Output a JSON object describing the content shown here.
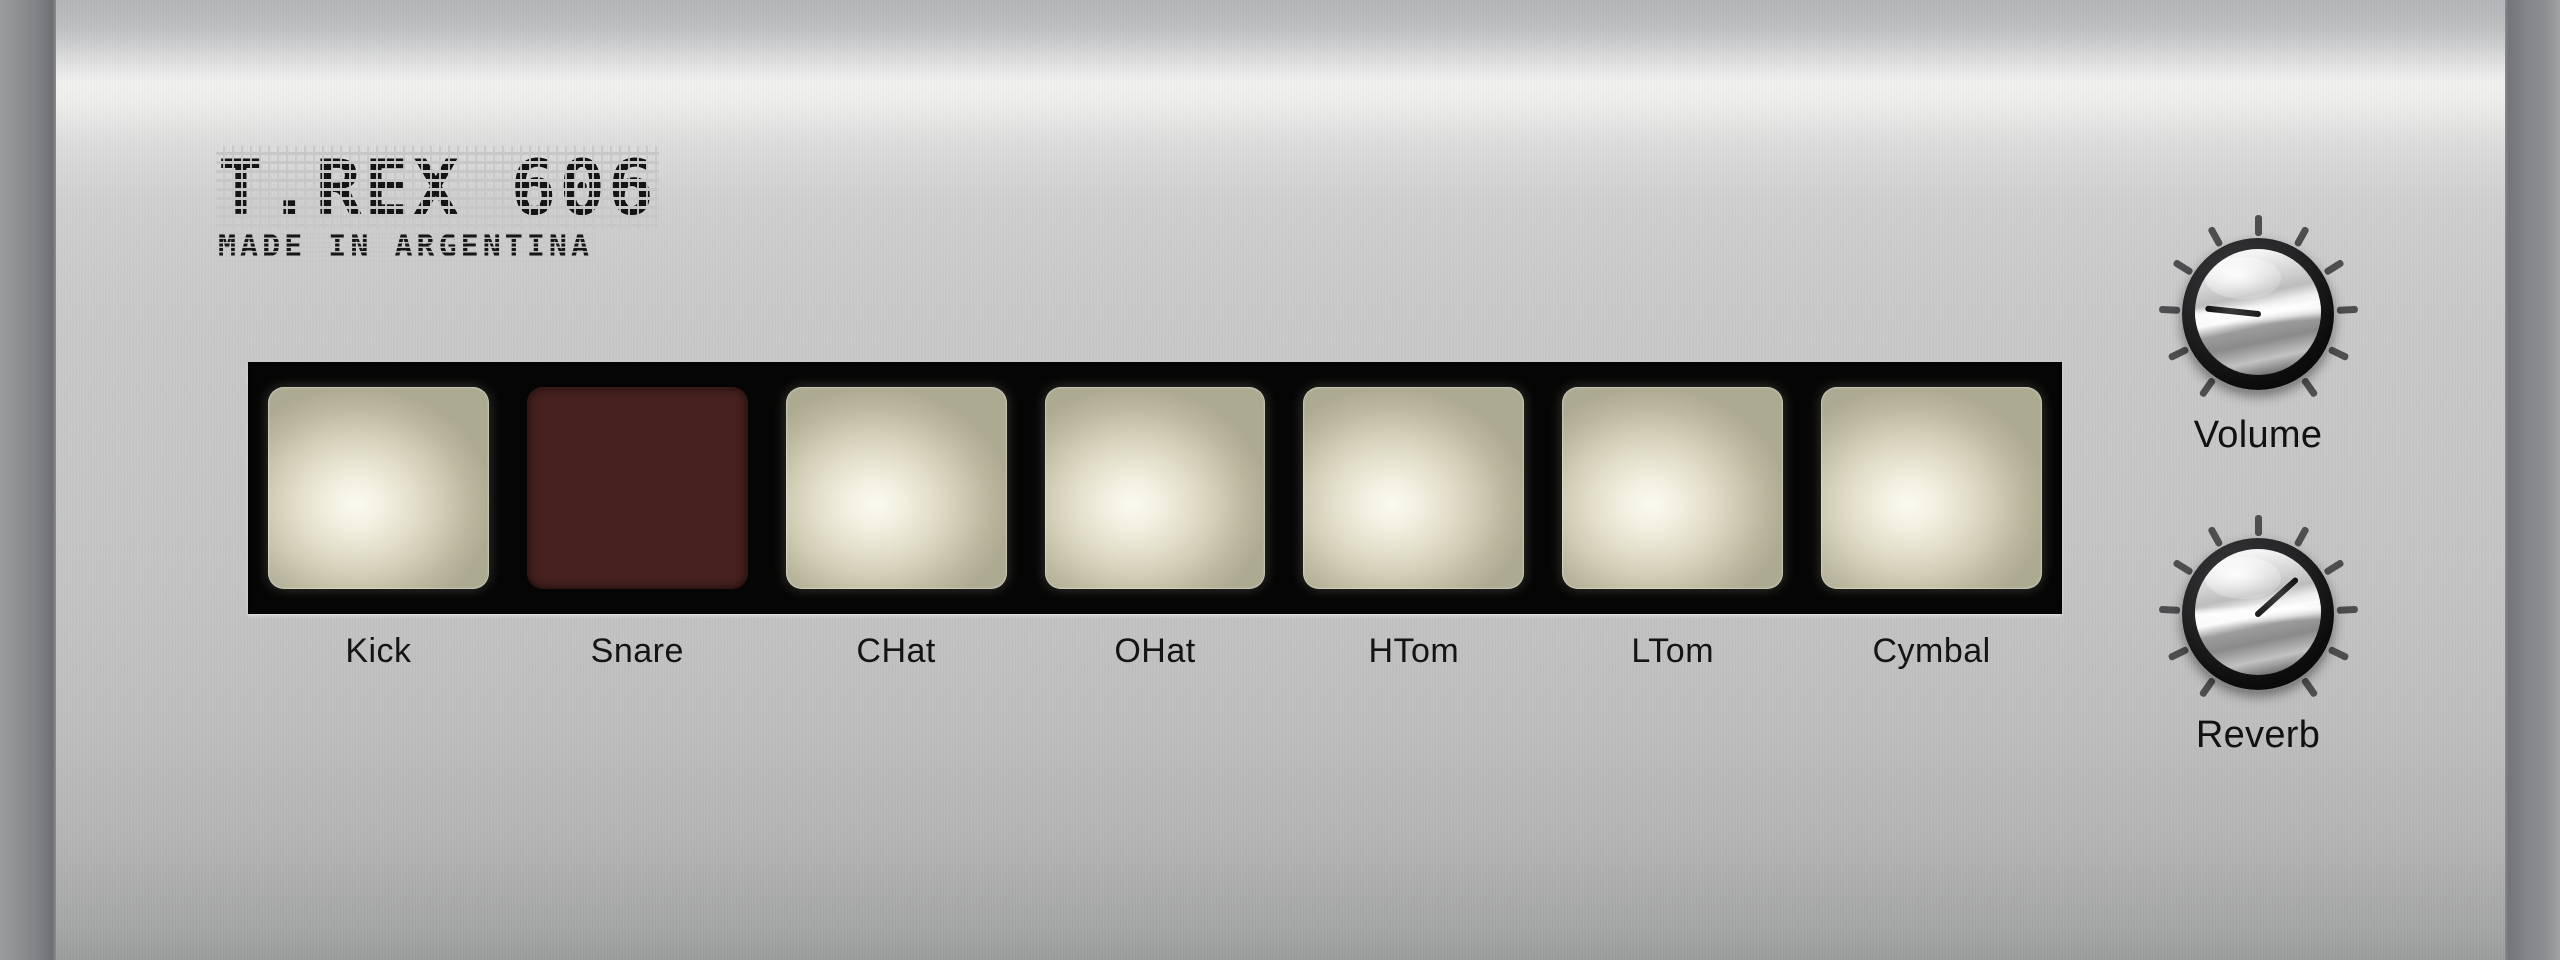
{
  "device": {
    "brand_title": "T.REX 606",
    "brand_subtitle": "MADE IN ARGENTINA"
  },
  "pads": [
    {
      "label": "Kick",
      "state": "lit",
      "color": "#f3f1e2"
    },
    {
      "label": "Snare",
      "state": "unlit",
      "color": "#46211e"
    },
    {
      "label": "CHat",
      "state": "lit",
      "color": "#f3f1e2"
    },
    {
      "label": "OHat",
      "state": "lit",
      "color": "#f3f1e2"
    },
    {
      "label": "HTom",
      "state": "lit",
      "color": "#f3f1e2"
    },
    {
      "label": "LTom",
      "state": "lit",
      "color": "#f3f1e2"
    },
    {
      "label": "Cymbal",
      "state": "lit",
      "color": "#f3f1e2"
    }
  ],
  "knobs": [
    {
      "label": "Volume",
      "angle_deg": 96,
      "tick_count": 11
    },
    {
      "label": "Reverb",
      "angle_deg": 228,
      "tick_count": 11
    }
  ],
  "theme": {
    "panel_light": "#f2f3f1",
    "panel_base": "#c6c7c6",
    "bezel": "#74757a",
    "pad_strip": "#050505",
    "pad_lit": "#f3f1e2",
    "pad_unlit": "#46211e",
    "text": "#141414",
    "tick": "#4e4e50"
  }
}
